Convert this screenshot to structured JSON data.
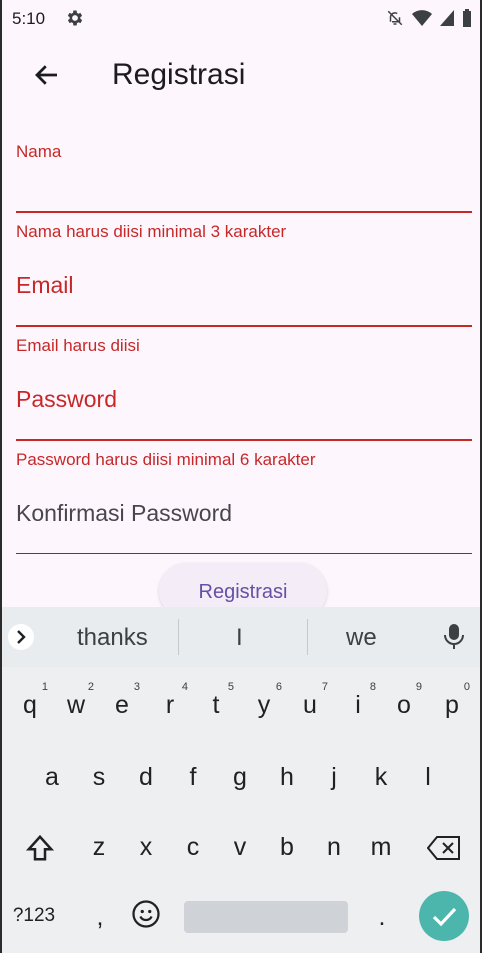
{
  "status": {
    "time": "5:10"
  },
  "appbar": {
    "title": "Registrasi"
  },
  "form": {
    "nama": {
      "label": "Nama",
      "helper": "Nama harus diisi minimal 3 karakter",
      "value": ""
    },
    "email": {
      "label": "Email",
      "helper": "Email harus diisi",
      "value": ""
    },
    "password": {
      "label": "Password",
      "helper": "Password harus diisi minimal 6 karakter",
      "value": ""
    },
    "konfirmasi": {
      "label": "Konfirmasi Password",
      "value": ""
    },
    "submit_label": "Registrasi"
  },
  "keyboard": {
    "suggestions": [
      "thanks",
      "I",
      "we"
    ],
    "row1": [
      "q",
      "w",
      "e",
      "r",
      "t",
      "y",
      "u",
      "i",
      "o",
      "p"
    ],
    "row1_hints": [
      "1",
      "2",
      "3",
      "4",
      "5",
      "6",
      "7",
      "8",
      "9",
      "0"
    ],
    "row2": [
      "a",
      "s",
      "d",
      "f",
      "g",
      "h",
      "j",
      "k",
      "l"
    ],
    "row3": [
      "z",
      "x",
      "c",
      "v",
      "b",
      "n",
      "m"
    ],
    "symbols_label": "?123",
    "comma": ",",
    "period": "."
  },
  "colors": {
    "error": "#c62828",
    "accent": "#6750a4",
    "confirm": "#4db6ac"
  }
}
